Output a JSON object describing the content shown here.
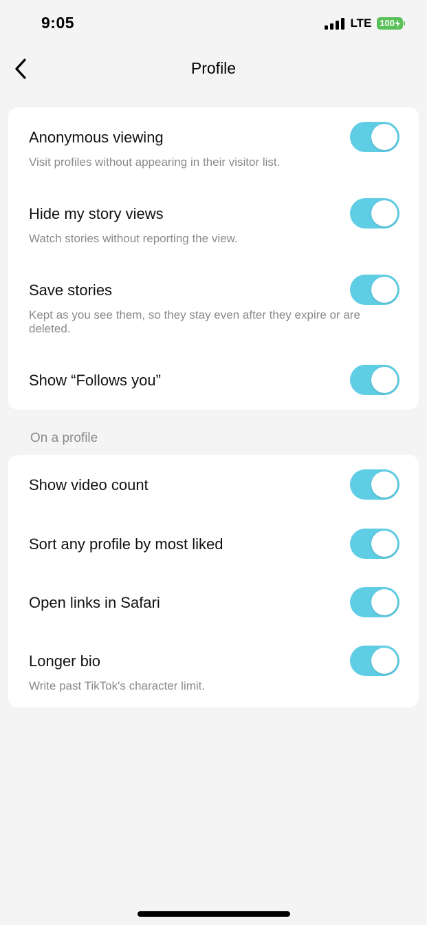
{
  "status_bar": {
    "time": "9:05",
    "network": "LTE",
    "battery": "100"
  },
  "nav": {
    "title": "Profile",
    "back_icon": "chevron-left-icon"
  },
  "colors": {
    "toggle_on": "#5fcde4",
    "background": "#f4f4f4",
    "card": "#ffffff",
    "battery": "#5ac05a"
  },
  "section1": {
    "rows": [
      {
        "title": "Anonymous viewing",
        "description": "Visit profiles without appearing in their visitor list.",
        "enabled": true
      },
      {
        "title": "Hide my story views",
        "description": "Watch stories without reporting the view.",
        "enabled": true
      },
      {
        "title": "Save stories",
        "description": "Kept as you see them, so they stay even after they expire or are deleted.",
        "enabled": true
      },
      {
        "title": "Show “Follows you”",
        "description": "",
        "enabled": true
      }
    ]
  },
  "section2": {
    "header": "On a profile",
    "rows": [
      {
        "title": "Show video count",
        "description": "",
        "enabled": true
      },
      {
        "title": "Sort any profile by most liked",
        "description": "",
        "enabled": true
      },
      {
        "title": "Open links in Safari",
        "description": "",
        "enabled": true
      },
      {
        "title": "Longer bio",
        "description": "Write past TikTok's character limit.",
        "enabled": true
      }
    ]
  }
}
